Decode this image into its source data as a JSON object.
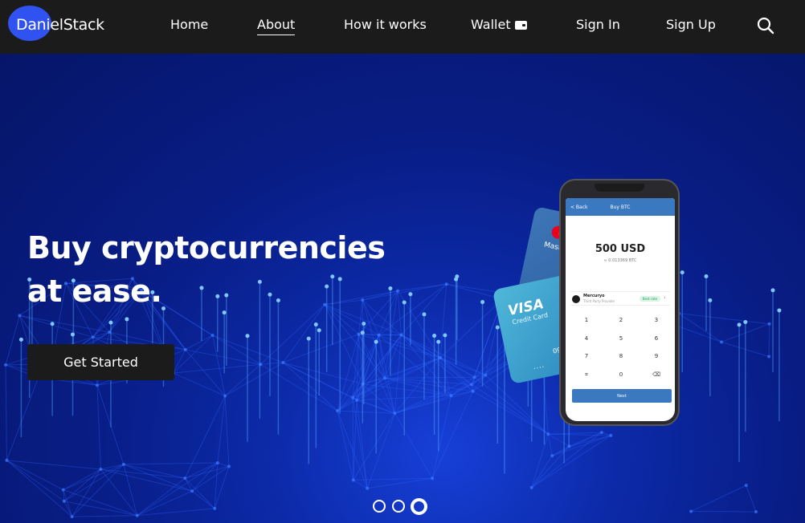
{
  "nav": {
    "logo": "DanielStack",
    "items": [
      {
        "label": "Home"
      },
      {
        "label": "About",
        "active": true
      },
      {
        "label": "How it works"
      },
      {
        "label": "Wallet"
      },
      {
        "label": "Sign In"
      },
      {
        "label": "Sign Up"
      }
    ],
    "search_icon": "search-icon",
    "wallet_icon": "wallet-icon"
  },
  "hero": {
    "headline_line1": "Buy cryptocurrencies",
    "headline_line2": "at ease.",
    "cta_label": "Get Started",
    "carousel": {
      "count": 3,
      "active_index": 2
    }
  },
  "cards": {
    "mastercard_label": "Mastercard",
    "visa_label": "VISA",
    "visa_sub": "Credit Card",
    "visa_number": "0908",
    "visa_dots": "...."
  },
  "phone": {
    "back": "< Back",
    "title": "Buy BTC",
    "amount": "500 USD",
    "btc_amount": "≈ 0.013369 BTC",
    "provider_name": "Mercuryo",
    "provider_sub": "Third Party Provider",
    "provider_badge": "Best rate",
    "keypad": [
      "1",
      "2",
      "3",
      "4",
      "5",
      "6",
      "7",
      "8",
      "9",
      "0"
    ],
    "next_label": "Next"
  },
  "colors": {
    "nav_bg": "#1b1b1c",
    "logo_accent": "#2f52f0",
    "hero_bg": "#0a1a6e",
    "cta_bg": "#1b1b1c",
    "app_blue": "#3a78c0"
  }
}
